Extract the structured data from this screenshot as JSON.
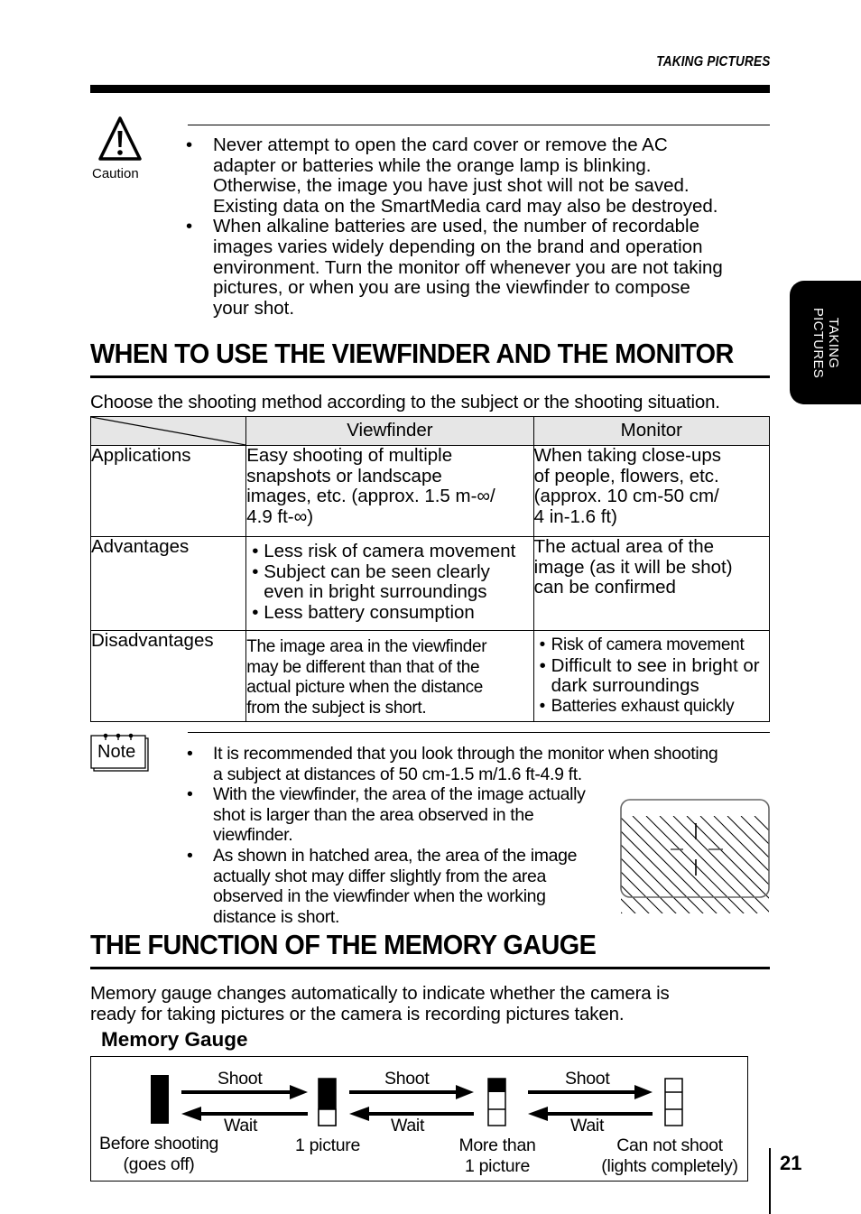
{
  "header": {
    "running_head": "TAKING PICTURES"
  },
  "side_tab": {
    "lines": [
      "TAKING",
      "PICTURES"
    ]
  },
  "caution": {
    "icon": "warning-triangle-icon",
    "label": "Caution",
    "items": [
      "Never attempt to open the card cover or remove the AC adapter or batteries while the orange lamp is blinking. Otherwise, the image you have just shot will not be saved. Existing data on the SmartMedia card may also be destroyed.",
      "When alkaline batteries are used, the number of recordable images varies widely depending on the brand and operation environment. Turn the monitor off whenever you are not taking pictures, or when you are using the viewfinder to compose your shot."
    ],
    "lines": [
      [
        "Never attempt to open the card cover or remove the AC",
        "adapter or batteries while the orange lamp is blinking.",
        "Otherwise, the image you have just shot will not be saved.",
        "Existing data on the SmartMedia card may also be destroyed."
      ],
      [
        "When alkaline batteries are used, the number of recordable",
        "images varies widely depending on the brand and operation",
        "environment. Turn the monitor off whenever you are not taking",
        "pictures, or when you are using the viewfinder to compose",
        "your shot."
      ]
    ]
  },
  "section1": {
    "title": "WHEN TO USE THE VIEWFINDER AND THE MONITOR",
    "intro": "Choose the shooting method according to the subject or the shooting situation.",
    "table": {
      "headers": [
        "",
        "Viewfinder",
        "Monitor"
      ],
      "rows": [
        {
          "label": "Applications",
          "viewfinder": [
            "Easy shooting of multiple",
            "snapshots or landscape",
            "images, etc. (approx. 1.5 m-∞/",
            "4.9 ft-∞)"
          ],
          "monitor": [
            "When taking close-ups",
            "of people, flowers, etc.",
            "(approx. 10 cm-50 cm/",
            "4 in-1.6 ft)"
          ]
        },
        {
          "label": "Advantages",
          "viewfinder": [
            "Less risk of camera movement",
            "Subject can be seen clearly even in bright surroundings",
            "Less battery consumption"
          ],
          "monitor": [
            "The actual area of the",
            "image (as it will be shot)",
            "can be confirmed"
          ]
        },
        {
          "label": "Disadvantages",
          "viewfinder": [
            "The image area in the viewfinder",
            "may be different than that of the",
            "actual picture when the distance",
            "from the subject is short."
          ],
          "monitor": [
            "Risk of camera movement",
            "Difficult to see in bright or dark surroundings",
            "Batteries exhaust quickly"
          ]
        }
      ]
    }
  },
  "note": {
    "icon": "note-pad-icon",
    "label": "Note",
    "lines": [
      [
        "It is recommended that you look through the monitor when shooting",
        "a subject at distances of 50 cm-1.5 m/1.6 ft-4.9 ft."
      ],
      [
        "With the viewfinder, the area of the image actually",
        "shot is larger than the area observed in the",
        "viewfinder."
      ],
      [
        "As shown in hatched area, the area of the image",
        "actually shot may differ slightly from the area",
        "observed in the viewfinder when the working",
        "distance is short."
      ]
    ],
    "figure": "viewfinder-hatched-area-diagram"
  },
  "section2": {
    "title": "THE FUNCTION OF THE MEMORY GAUGE",
    "intro_lines": [
      "Memory gauge changes automatically to indicate whether the camera is",
      "ready for taking pictures or the camera is recording pictures taken."
    ],
    "subtitle": "Memory Gauge",
    "gauge": {
      "arrow_forward": "Shoot",
      "arrow_back": "Wait",
      "states": [
        {
          "label_lines": [
            "Before shooting",
            "(goes off)"
          ],
          "filled_segments": 3,
          "total_segments": 3,
          "segment_borders": false
        },
        {
          "label_lines": [
            "1 picture"
          ],
          "filled_segments": 2,
          "total_segments": 3,
          "segment_borders": false
        },
        {
          "label_lines": [
            "More than",
            "1 picture"
          ],
          "filled_segments": 1,
          "total_segments": 3,
          "segment_borders": true
        },
        {
          "label_lines": [
            "Can not shoot",
            "(lights completely)"
          ],
          "filled_segments": 0,
          "total_segments": 3,
          "segment_borders": true
        }
      ]
    }
  },
  "footer": {
    "page_number": "21"
  }
}
